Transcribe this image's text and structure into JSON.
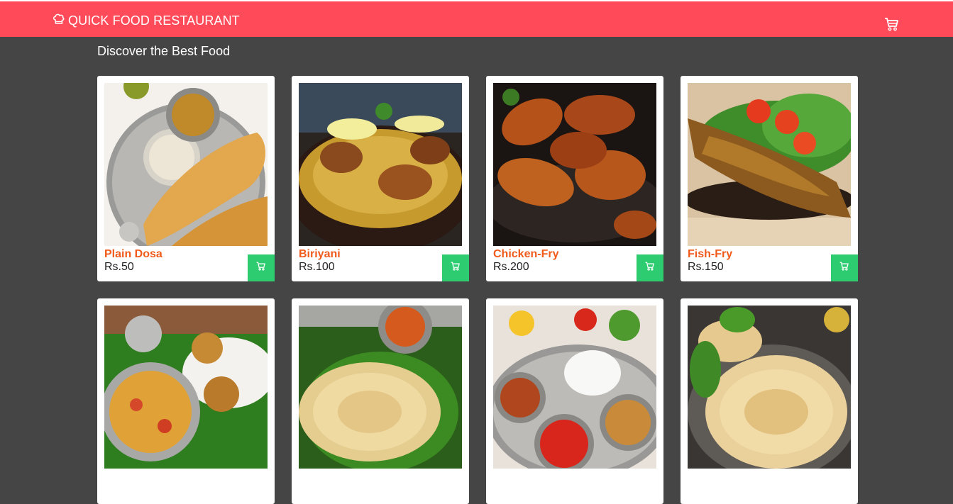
{
  "app": {
    "brand_icon": "chef-hat-icon",
    "title": "QUICK FOOD RESTAURANT",
    "cart_icon": "cart-icon"
  },
  "colors": {
    "navbar": "#ff4a59",
    "background": "#454545",
    "item_name": "#f05a1a",
    "add_button": "#2dcc70"
  },
  "main": {
    "heading": "Discover the Best Food"
  },
  "foods": [
    {
      "name": "Plain Dosa",
      "price": "Rs.50",
      "add_icon": "cart-icon"
    },
    {
      "name": "Biriyani",
      "price": "Rs.100",
      "add_icon": "cart-icon"
    },
    {
      "name": "Chicken-Fry",
      "price": "Rs.200",
      "add_icon": "cart-icon"
    },
    {
      "name": "Fish-Fry",
      "price": "Rs.150",
      "add_icon": "cart-icon"
    },
    {
      "name": "",
      "price": "",
      "add_icon": "cart-icon"
    },
    {
      "name": "",
      "price": "",
      "add_icon": "cart-icon"
    },
    {
      "name": "",
      "price": "",
      "add_icon": "cart-icon"
    },
    {
      "name": "",
      "price": "",
      "add_icon": "cart-icon"
    }
  ]
}
